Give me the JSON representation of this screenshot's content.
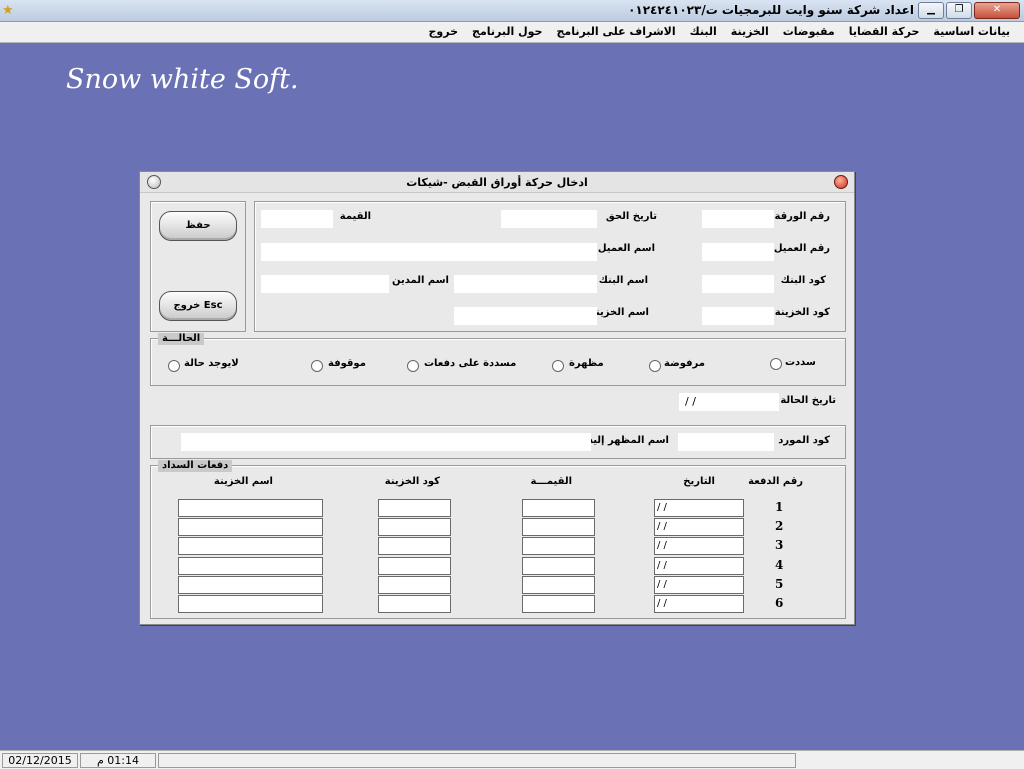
{
  "window": {
    "title": "اعداد شركة سنو وايت للبرمجيات ت/٠١٢٤٢٤١٠٢٣"
  },
  "menu": [
    "بيانات اساسية",
    "حركة القضايا",
    "مقبوضات",
    "الخزينة",
    "البنك",
    "الاشراف على البرنامج",
    "حول البرنامج",
    "خروج"
  ],
  "brand": "Snow white Soft.",
  "dialog": {
    "title": "ادخال حركة أوراق القبض -شيكات",
    "buttons": {
      "save": "حفظ",
      "exit": "خروج Esc"
    },
    "labels": {
      "paper_no": "رقم الورقة",
      "due_date": "تاريخ الحق",
      "value": "القيمة",
      "client_no": "رقم العميل",
      "client_name": "اسم العميل",
      "bank_code": "كود البنك",
      "bank_name": "اسم البنك",
      "debtor_name": "اسم المدين",
      "treasury_code": "كود الخزينة",
      "treasury_name": "اسم الخزينة"
    },
    "status": {
      "title": "الحالـــة",
      "options": [
        "سددت",
        "مرفوضة",
        "مظهرة",
        "مسددة على دفعات",
        "موقوفة",
        "لايوجد حالة"
      ]
    },
    "status_date": {
      "label": "تاريخ الحالة",
      "value": " /  /"
    },
    "supplier": {
      "code_label": "كود المورد",
      "endorsee_label": "اسم المظهر إليه"
    },
    "payments": {
      "title": "دفعات السداد",
      "headers": {
        "no": "رقم الدفعة",
        "date": "التاريخ",
        "value": "القيمـــة",
        "treasury_code": "كود الخزينة",
        "treasury_name": "اسم الخزينة"
      },
      "rows": [
        {
          "no": "1",
          "date": " /  /"
        },
        {
          "no": "2",
          "date": " /  /"
        },
        {
          "no": "3",
          "date": " /  /"
        },
        {
          "no": "4",
          "date": " /  /"
        },
        {
          "no": "5",
          "date": " /  /"
        },
        {
          "no": "6",
          "date": " /  /"
        }
      ]
    }
  },
  "statusbar": {
    "date": "02/12/2015",
    "time": "01:14 م"
  }
}
